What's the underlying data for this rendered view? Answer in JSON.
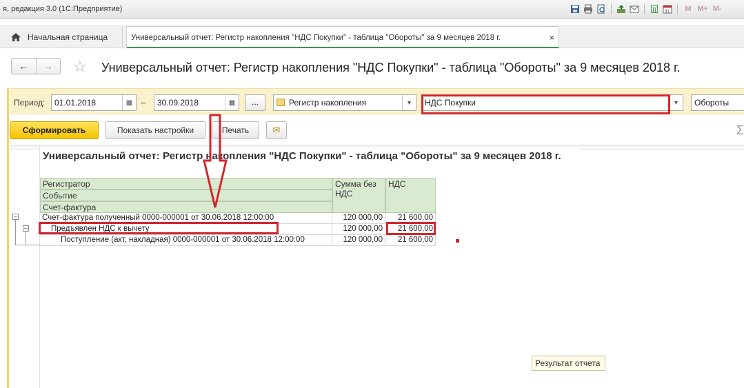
{
  "window": {
    "app_title": "я, редакция 3.0  (1С:Предприятие)"
  },
  "titlebar_icons": [
    "save-icon",
    "print-icon",
    "preview-icon",
    "export-icon",
    "mail-icon",
    "calculator-icon",
    "calendar-icon"
  ],
  "titlebar_m_buttons": [
    "M",
    "M+",
    "M-"
  ],
  "tabs": [
    {
      "label": "Начальная страница"
    },
    {
      "label": "Универсальный отчет: Регистр накопления \"НДС Покупки\" - таблица \"Обороты\" за 9 месяцев 2018 г."
    }
  ],
  "tab_close_glyph": "×",
  "page": {
    "title": "Универсальный отчет: Регистр накопления \"НДС Покупки\" - таблица \"Обороты\" за 9 месяцев 2018 г."
  },
  "params": {
    "period_label": "Период:",
    "date_from": "01.01.2018",
    "dash": "–",
    "date_to": "30.09.2018",
    "dots_label": "...",
    "source_type": "Регистр накопления",
    "register_name": "НДС Покупки",
    "table_name": "Обороты"
  },
  "toolbar": {
    "generate_label": "Сформировать",
    "settings_label": "Показать настройки",
    "print_label": "Печать",
    "sigma": "Σ"
  },
  "report": {
    "title": "Универсальный отчет: Регистр накопления \"НДС Покупки\" - таблица \"Обороты\" за 9 месяцев 2018 г.",
    "headers": {
      "group1": "Регистратор",
      "group2": "Событие",
      "group3": "Счет-фактура",
      "col_sum": "Сумма без НДС",
      "col_vat": "НДС"
    },
    "rows": [
      {
        "label": "Счет-фактура полученный 0000-000001 от 30.06.2018 12:00:00",
        "sum": "120 000,00",
        "vat": "21 600,00"
      },
      {
        "label": "Предъявлен НДС к вычету",
        "sum": "120 000,00",
        "vat": "21 600,00"
      },
      {
        "label": "Поступление (акт, накладная) 0000-000001 от 30.06.2018 12:00:00",
        "sum": "120 000,00",
        "vat": "21 600,00"
      }
    ]
  },
  "tooltip": "Результат отчета",
  "accent_colors": {
    "annotation_red": "#d4262e",
    "header_green": "#d9ead0",
    "primary_yellow": "#f3c400",
    "tab_underline": "#2a9a4a"
  }
}
